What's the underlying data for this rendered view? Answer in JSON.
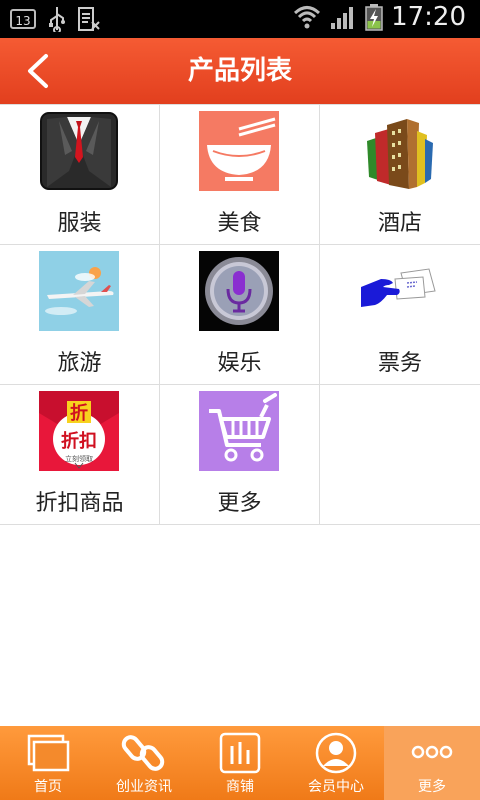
{
  "status_bar": {
    "notification_badge": "13",
    "time": "17:20",
    "icons": [
      "usb-icon",
      "sim-icon",
      "wifi-icon",
      "signal-icon",
      "battery-charging-icon"
    ]
  },
  "header": {
    "title": "产品列表",
    "background": "#ee4b27"
  },
  "products": [
    {
      "label": "服装",
      "icon": "suit-icon"
    },
    {
      "label": "美食",
      "icon": "bowl-chopsticks-icon"
    },
    {
      "label": "酒店",
      "icon": "buildings-icon"
    },
    {
      "label": "旅游",
      "icon": "airplane-icon"
    },
    {
      "label": "娱乐",
      "icon": "microphone-icon"
    },
    {
      "label": "票务",
      "icon": "ticket-icon"
    },
    {
      "label": "折扣商品",
      "icon": "discount-envelope-icon"
    },
    {
      "label": "更多",
      "icon": "shopping-cart-icon"
    }
  ],
  "discount_icon_text": {
    "top": "折",
    "middle": "折扣",
    "bottom": "立刻领取"
  },
  "tabbar": {
    "accent": "#f58426",
    "tabs": [
      {
        "label": "首页",
        "icon": "home-pages-icon"
      },
      {
        "label": "创业资讯",
        "icon": "link-icon"
      },
      {
        "label": "商铺",
        "icon": "shop-bars-icon"
      },
      {
        "label": "会员中心",
        "icon": "user-icon"
      },
      {
        "label": "更多",
        "icon": "more-dots-icon"
      }
    ],
    "active_index": 4
  }
}
